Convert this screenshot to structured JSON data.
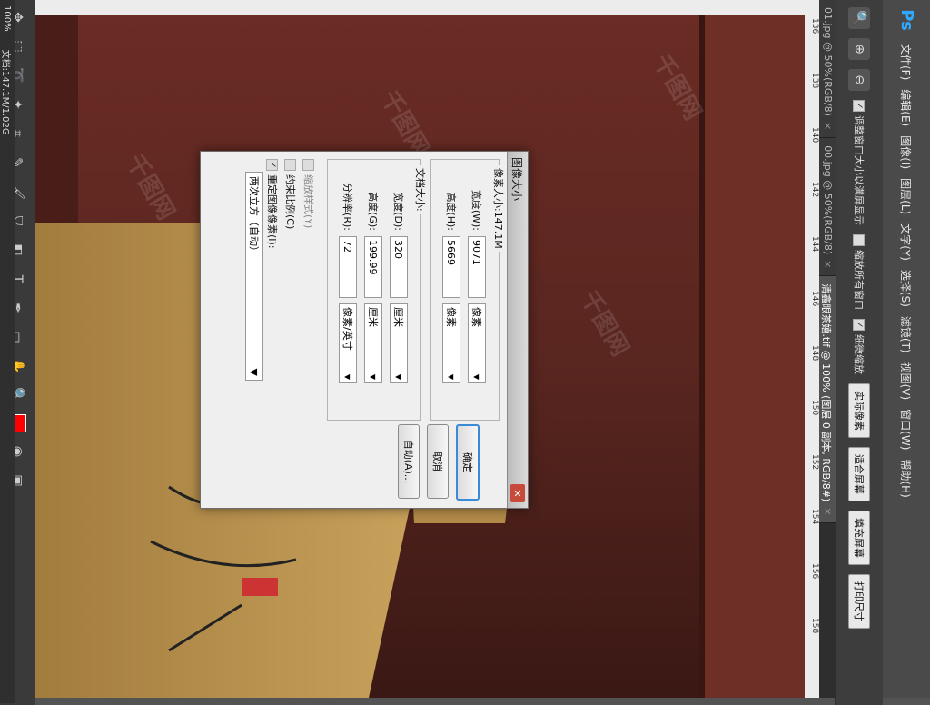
{
  "app": {
    "logo": "Ps",
    "menu": [
      "文件(F)",
      "编辑(E)",
      "图像(I)",
      "图层(L)",
      "文字(Y)",
      "选择(S)",
      "滤镜(T)",
      "视图(V)",
      "窗口(W)",
      "帮助(H)"
    ]
  },
  "options": {
    "resize_windows": "调整窗口大小以满屏显示",
    "zoom_all": "缩放所有窗口",
    "scrubby_zoom": "细微缩放",
    "actual_pixels": "实际像素",
    "fit_screen": "适合屏幕",
    "fill_screen": "填充屏幕",
    "print_size": "打印尺寸"
  },
  "tabs": [
    {
      "label": "01.jpg @ 50%(RGB/8)",
      "active": false
    },
    {
      "label": "00.jpg @ 50%(RGB/8)",
      "active": false
    },
    {
      "label": "清鑫眼茶嬉.tif @ 100% (图层 0 副本, RGB/8#)",
      "active": true
    }
  ],
  "ruler": {
    "h_ticks": [
      "136",
      "138",
      "140",
      "142",
      "144",
      "146",
      "148",
      "150",
      "152",
      "154",
      "156",
      "158"
    ]
  },
  "status": {
    "zoom": "100%",
    "doc": "文档:147.1M/1.02G"
  },
  "dialog": {
    "title": "图像大小",
    "pixel_group": "像素大小:147.1M",
    "width_label": "宽度(W):",
    "width_value": "9071",
    "width_unit": "像素",
    "height_label": "高度(H):",
    "height_value": "5669",
    "height_unit": "像素",
    "doc_group": "文档大小:",
    "doc_width_label": "宽度(D):",
    "doc_width_value": "320",
    "doc_width_unit": "厘米",
    "doc_height_label": "高度(G):",
    "doc_height_value": "199.99",
    "doc_height_unit": "厘米",
    "res_label": "分辨率(R):",
    "res_value": "72",
    "res_unit": "像素/英寸",
    "ok": "确定",
    "cancel": "取消",
    "auto": "自动(A)...",
    "scale_styles": "缩放样式(Y)",
    "constrain": "约束比例(C)",
    "resample": "重定图像像素(I):",
    "resample_method": "两次立方（自动）",
    "close": "✕"
  },
  "watermark": "千图网"
}
